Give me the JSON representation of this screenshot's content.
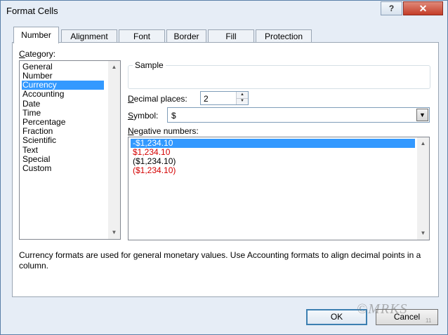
{
  "window": {
    "title": "Format Cells",
    "help_label": "?",
    "close_label": "✕"
  },
  "tabs": [
    {
      "label": "Number",
      "active": true
    },
    {
      "label": "Alignment"
    },
    {
      "label": "Font"
    },
    {
      "label": "Border"
    },
    {
      "label": "Fill"
    },
    {
      "label": "Protection"
    }
  ],
  "category": {
    "label_first": "C",
    "label_rest": "ategory:",
    "items": [
      "General",
      "Number",
      "Currency",
      "Accounting",
      "Date",
      "Time",
      "Percentage",
      "Fraction",
      "Scientific",
      "Text",
      "Special",
      "Custom"
    ],
    "selected": "Currency"
  },
  "sample": {
    "label": "Sample",
    "value": ""
  },
  "decimal_places": {
    "label_first": "D",
    "label_rest": "ecimal places:",
    "value": "2"
  },
  "symbol": {
    "label_first": "S",
    "label_rest": "ymbol:",
    "value": "$"
  },
  "negative_numbers": {
    "label_first": "N",
    "label_rest": "egative numbers:",
    "items": [
      "-$1,234.10",
      "$1,234.10",
      "($1,234.10)",
      "($1,234.10)"
    ],
    "item_colors": [
      "#000000",
      "#d40000",
      "#000000",
      "#d40000"
    ],
    "selected_index": 0
  },
  "description": "Currency formats are used for general monetary values.  Use Accounting formats to align decimal points in a column.",
  "buttons": {
    "ok": "OK",
    "cancel": "Cancel"
  },
  "watermark": "©MRKS",
  "page_number": "11",
  "colors": {
    "selection": "#3399ff",
    "negative_red": "#d40000"
  }
}
